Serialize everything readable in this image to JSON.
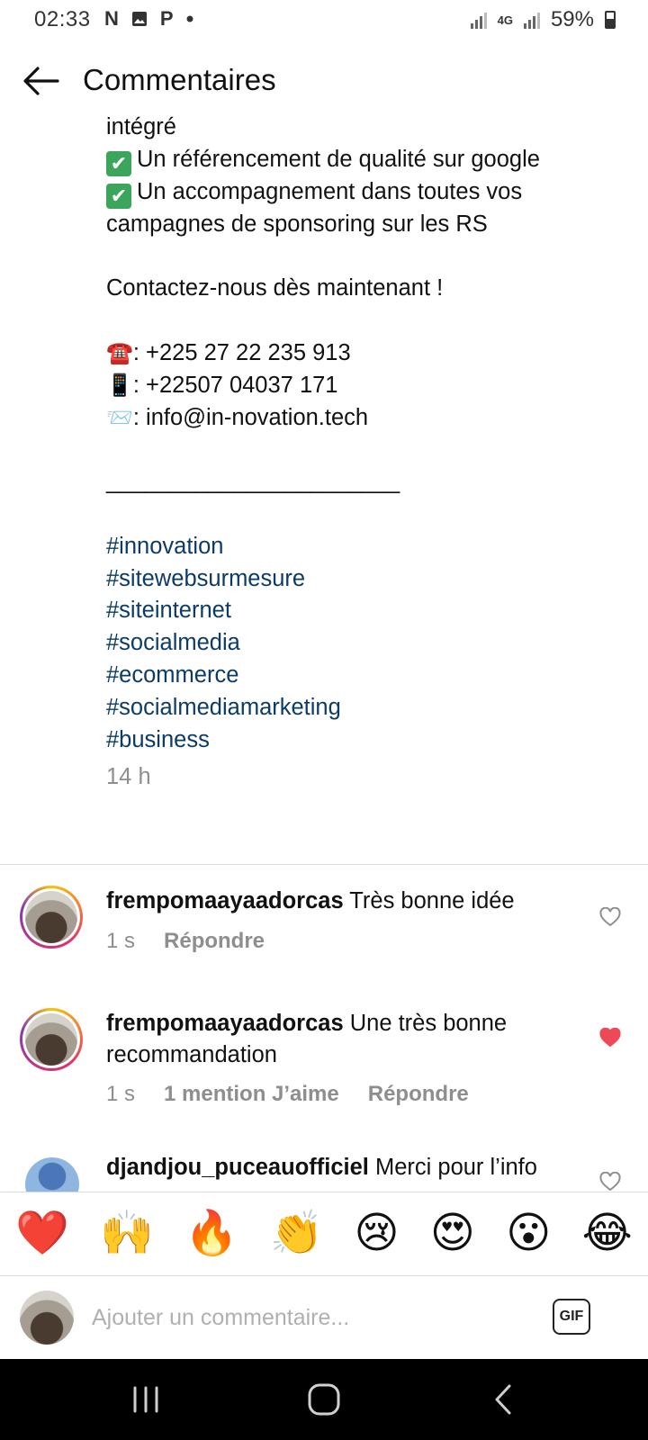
{
  "status_bar": {
    "time": "02:33",
    "notification_icons": [
      "N",
      "P"
    ],
    "network": "4G",
    "battery": "59%"
  },
  "header": {
    "title": "Commentaires"
  },
  "caption": {
    "first_line": "intégré",
    "lines": [
      "Un référencement de qualité sur google",
      "Un accompagnement dans toutes vos campagnes de sponsoring sur les RS"
    ],
    "contact": "Contactez-nous dès maintenant !",
    "phone": ": +225 27 22 235 913",
    "mobile": ": +22507 04037 171",
    "email": ": info@in-novation.tech",
    "separator": "_______________________",
    "hashtags": [
      "#innovation",
      "#sitewebsurmesure",
      "#siteinternet",
      "#socialmedia",
      "#ecommerce",
      "#socialmediamarketing",
      "#business"
    ],
    "age": "14 h"
  },
  "comments": [
    {
      "username": "frempomaayaadorcas",
      "text": "Très bonne idée",
      "age": "1 s",
      "reply": "Répondre",
      "liked": false
    },
    {
      "username": "frempomaayaadorcas",
      "text": "Une très bonne recommandation",
      "age": "1 s",
      "likes": "1 mention J’aime",
      "reply": "Répondre",
      "liked": true
    },
    {
      "username": "djandjou_puceauofficiel",
      "text": "Merci pour l’info",
      "liked": false
    }
  ],
  "reactions": [
    "❤️",
    "🙌",
    "🔥",
    "👏",
    "😢",
    "😍",
    "😮",
    "😂"
  ],
  "composer": {
    "placeholder": "Ajouter un commentaire...",
    "gif_label": "GIF"
  },
  "colors": {
    "hashtag": "#0b3b66",
    "like_active": "#ed4956",
    "meta_gray": "#8e8e8e"
  }
}
